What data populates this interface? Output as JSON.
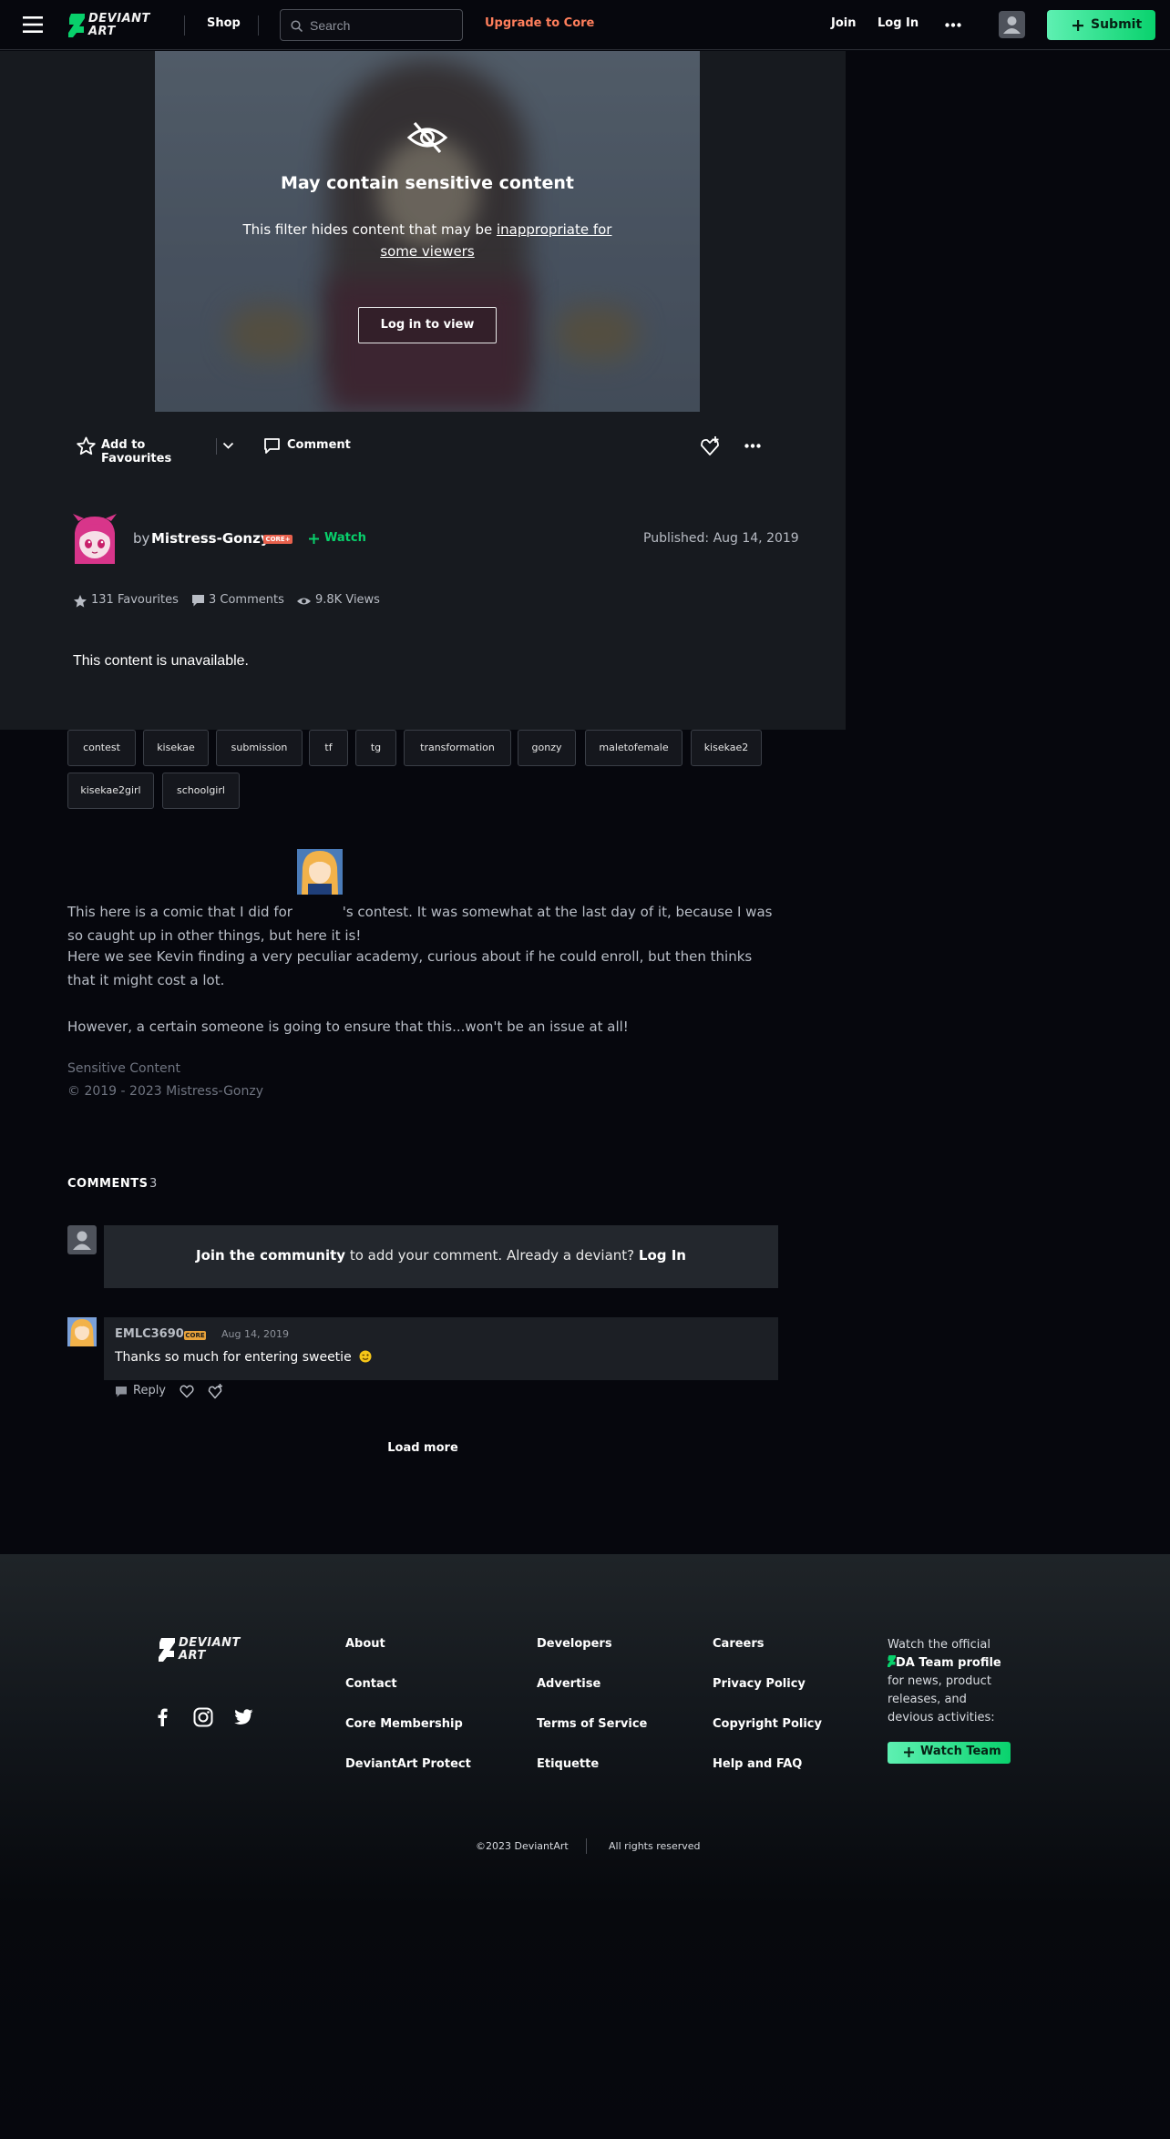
{
  "header": {
    "logo_line1": "DEVIANT",
    "logo_line2": "ART",
    "shop": "Shop",
    "search_placeholder": "Search",
    "upgrade": "Upgrade to Core",
    "join": "Join",
    "login": "Log In",
    "submit": "Submit"
  },
  "colors": {
    "accent": "#08d06b",
    "upgrade": "#ff7f5c",
    "core_badge": "#e8614d"
  },
  "sensitive": {
    "title": "May contain sensitive content",
    "desc_before": "This filter hides content that may be ",
    "desc_link": "inappropriate for some viewers",
    "login_button": "Log in to view"
  },
  "actions": {
    "favourite": "Add to Favourites",
    "comment": "Comment"
  },
  "author": {
    "by": "by",
    "name": "Mistress-Gonzy",
    "badge": "CORE+",
    "watch": "Watch",
    "published": "Published: Aug 14, 2019"
  },
  "stats": {
    "favourites": "131 Favourites",
    "comments": "3 Comments",
    "views": "9.8K Views"
  },
  "unavailable": "This content is unavailable.",
  "tags": [
    "contest",
    "kisekae",
    "submission",
    "tf",
    "tg",
    "transformation",
    "gonzy",
    "maletofemale",
    "kisekae2",
    "kisekae2girl",
    "schoolgirl"
  ],
  "description": {
    "p1_before": "This here is a comic that I did for ",
    "p1_after": "'s contest. It was somewhat at the last day of it, because I was so caught up in other things, but here it is!",
    "p2": "Here we see Kevin finding a very peculiar academy, curious about if he could enroll, but then thinks that it might cost a lot.",
    "p3": "However, a certain someone is going to ensure that this...won't be an issue at all!",
    "sensitive_label": "Sensitive Content",
    "copyright": "© 2019 - 2023 Mistress-Gonzy"
  },
  "comments": {
    "heading": "COMMENTS",
    "count": "3",
    "join_bold": "Join the community",
    "join_mid": " to add your comment. Already a deviant? ",
    "join_login": "Log In",
    "items": [
      {
        "user": "EMLC3690",
        "badge": "CORE",
        "date": "Aug 14, 2019",
        "text": "Thanks so much for entering sweetie",
        "reply": "Reply"
      }
    ],
    "load_more": "Load more"
  },
  "footer": {
    "col1": [
      "About",
      "Contact",
      "Core Membership",
      "DeviantArt Protect"
    ],
    "col2": [
      "Developers",
      "Advertise",
      "Terms of Service",
      "Etiquette"
    ],
    "col3": [
      "Careers",
      "Privacy Policy",
      "Copyright Policy",
      "Help and FAQ"
    ],
    "watch_text_1": "Watch the official",
    "watch_text_profile": "DA Team profile",
    "watch_text_2": "for news, product releases, and devious activities:",
    "watch_button": "Watch Team",
    "copyright": "©2023 DeviantArt",
    "rights": "All rights reserved"
  }
}
